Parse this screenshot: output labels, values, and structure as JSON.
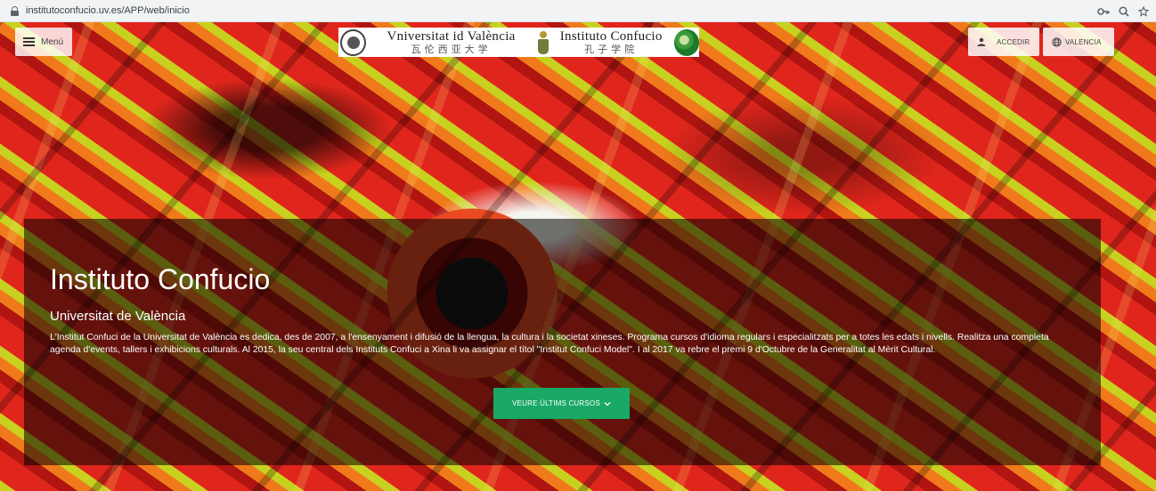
{
  "browser": {
    "url": "institutoconfucio.uv.es/APP/web/inicio"
  },
  "header": {
    "menu_label": "Menú",
    "logo": {
      "university_name": "Vniversitat id València",
      "university_chinese": "瓦伦西亚大学",
      "institute_name": "Instituto Confucio",
      "institute_chinese": "孔子学院"
    },
    "access_label": "ACCEDIR",
    "language_label": "VALENCIA"
  },
  "hero": {
    "title": "Instituto Confucio",
    "subtitle": "Universitat de València",
    "description": "L'Institut Confuci de la Universitat de València es dedica, des de 2007, a l'ensenyament i difusió de la llengua, la cultura i la societat xineses. Programa cursos d'idioma regulars i especialitzats per a totes les edats i nivells. Realitza una completa agenda d'events, tallers i exhibicions culturals. Al 2015, la seu central dels Instituts Confuci a Xina li va assignar el títol \"Institut Confuci Model\". I al 2017 va rebre el premi 9 d'Octubre de la Generalitat al Mèrit Cultural.",
    "cta_label": "VEURE ÚLTIMS CURSOS"
  },
  "colors": {
    "cta_green": "#19a865",
    "panel_overlay": "rgba(0,0,0,0.55)"
  },
  "icons": [
    "lock-icon",
    "key-icon",
    "search-icon",
    "star-icon",
    "menu-icon",
    "person-icon",
    "globe-icon",
    "chevron-down-icon"
  ]
}
